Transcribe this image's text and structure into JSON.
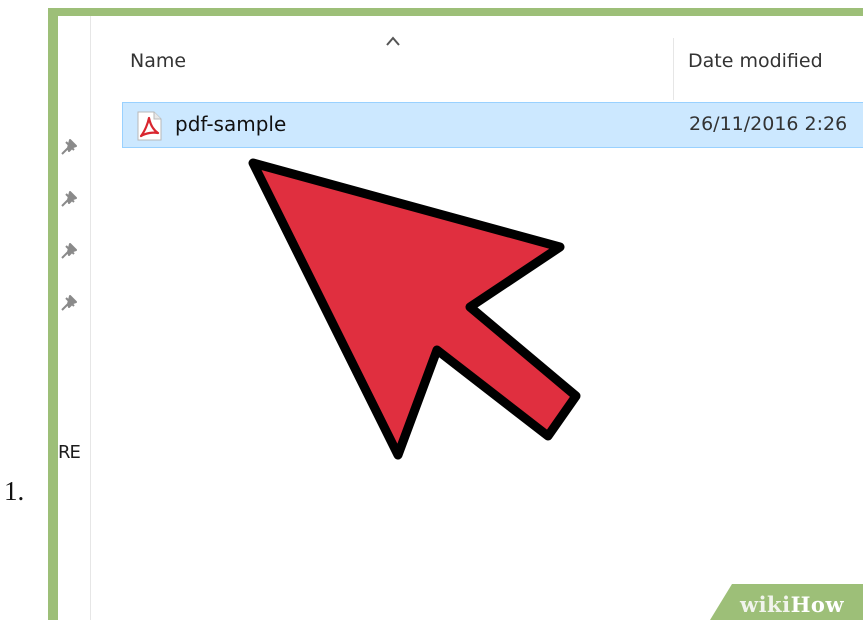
{
  "step": {
    "number": "1."
  },
  "explorer": {
    "nav_truncated_label": "RE",
    "nav_pins": [
      "pin-icon",
      "pin-icon",
      "pin-icon",
      "pin-icon"
    ],
    "columns": {
      "name": "Name",
      "date_modified": "Date modified"
    },
    "sort_indicator": "caret-up-icon",
    "files": [
      {
        "name": "pdf-sample",
        "date_modified": "26/11/2016 2:26",
        "icon": "pdf-file-icon",
        "selected": true
      }
    ]
  },
  "overlay": {
    "cursor": "red-arrow-cursor-icon"
  },
  "watermark": {
    "brand_light": "wiki",
    "brand_bold": "How"
  },
  "colors": {
    "frame": "#9dbf78",
    "selection_bg": "#cce8ff",
    "selection_border": "#99d1ff",
    "arrow_fill": "#e02f3f",
    "arrow_stroke": "#000000",
    "pdf_red": "#d9262f"
  }
}
